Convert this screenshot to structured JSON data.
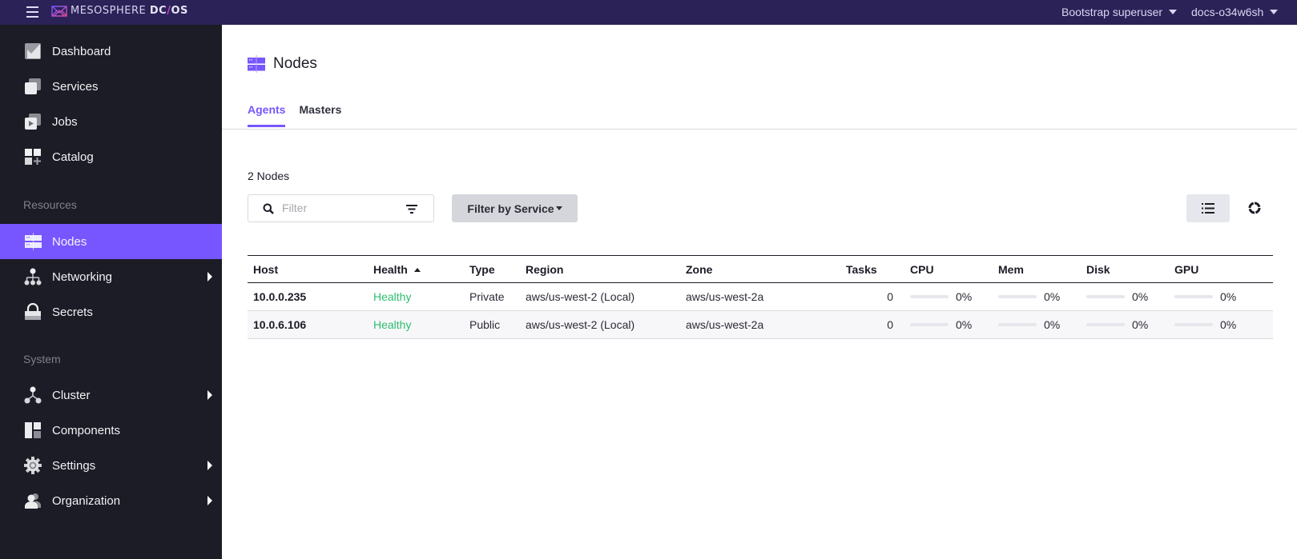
{
  "topbar": {
    "brand_light": "MESOSPHERE ",
    "brand_bold_1": "DC",
    "brand_slash": "/",
    "brand_bold_2": "OS",
    "user_label": "Bootstrap superuser",
    "cluster_label": "docs-o34w6sh"
  },
  "sidebar": {
    "items": [
      {
        "label": "Dashboard",
        "icon": "dashboard-icon"
      },
      {
        "label": "Services",
        "icon": "services-icon"
      },
      {
        "label": "Jobs",
        "icon": "jobs-icon"
      },
      {
        "label": "Catalog",
        "icon": "catalog-icon"
      }
    ],
    "sections": [
      {
        "title": "Resources",
        "items": [
          {
            "label": "Nodes",
            "icon": "nodes-icon",
            "active": true
          },
          {
            "label": "Networking",
            "icon": "networking-icon",
            "has_submenu": true
          },
          {
            "label": "Secrets",
            "icon": "lock-icon"
          }
        ]
      },
      {
        "title": "System",
        "items": [
          {
            "label": "Cluster",
            "icon": "cluster-icon",
            "has_submenu": true
          },
          {
            "label": "Components",
            "icon": "components-icon"
          },
          {
            "label": "Settings",
            "icon": "gear-icon",
            "has_submenu": true
          },
          {
            "label": "Organization",
            "icon": "users-icon",
            "has_submenu": true
          }
        ]
      }
    ]
  },
  "page": {
    "title": "Nodes",
    "tabs": [
      {
        "label": "Agents",
        "active": true
      },
      {
        "label": "Masters",
        "active": false
      }
    ],
    "node_count": "2 Nodes",
    "filter": {
      "placeholder": "Filter",
      "value": ""
    },
    "filter_by_service_label": "Filter by Service",
    "accent_color": "#7856ff",
    "healthy_color": "#2dbd6f"
  },
  "table": {
    "columns": [
      "Host",
      "Health",
      "Type",
      "Region",
      "Zone",
      "Tasks",
      "CPU",
      "Mem",
      "Disk",
      "GPU"
    ],
    "sorted_by": "Health",
    "sort_direction": "ascending",
    "rows": [
      {
        "host": "10.0.0.235",
        "health": "Healthy",
        "type": "Private",
        "region": "aws/us-west-2 (Local)",
        "zone": "aws/us-west-2a",
        "tasks": "0",
        "cpu": "0%",
        "cpu_pct": 0,
        "mem": "0%",
        "mem_pct": 0,
        "disk": "0%",
        "disk_pct": 0,
        "gpu": "0%",
        "gpu_pct": 0
      },
      {
        "host": "10.0.6.106",
        "health": "Healthy",
        "type": "Public",
        "region": "aws/us-west-2 (Local)",
        "zone": "aws/us-west-2a",
        "tasks": "0",
        "cpu": "0%",
        "cpu_pct": 0,
        "mem": "0%",
        "mem_pct": 0,
        "disk": "0%",
        "disk_pct": 0,
        "gpu": "0%",
        "gpu_pct": 0
      }
    ]
  }
}
